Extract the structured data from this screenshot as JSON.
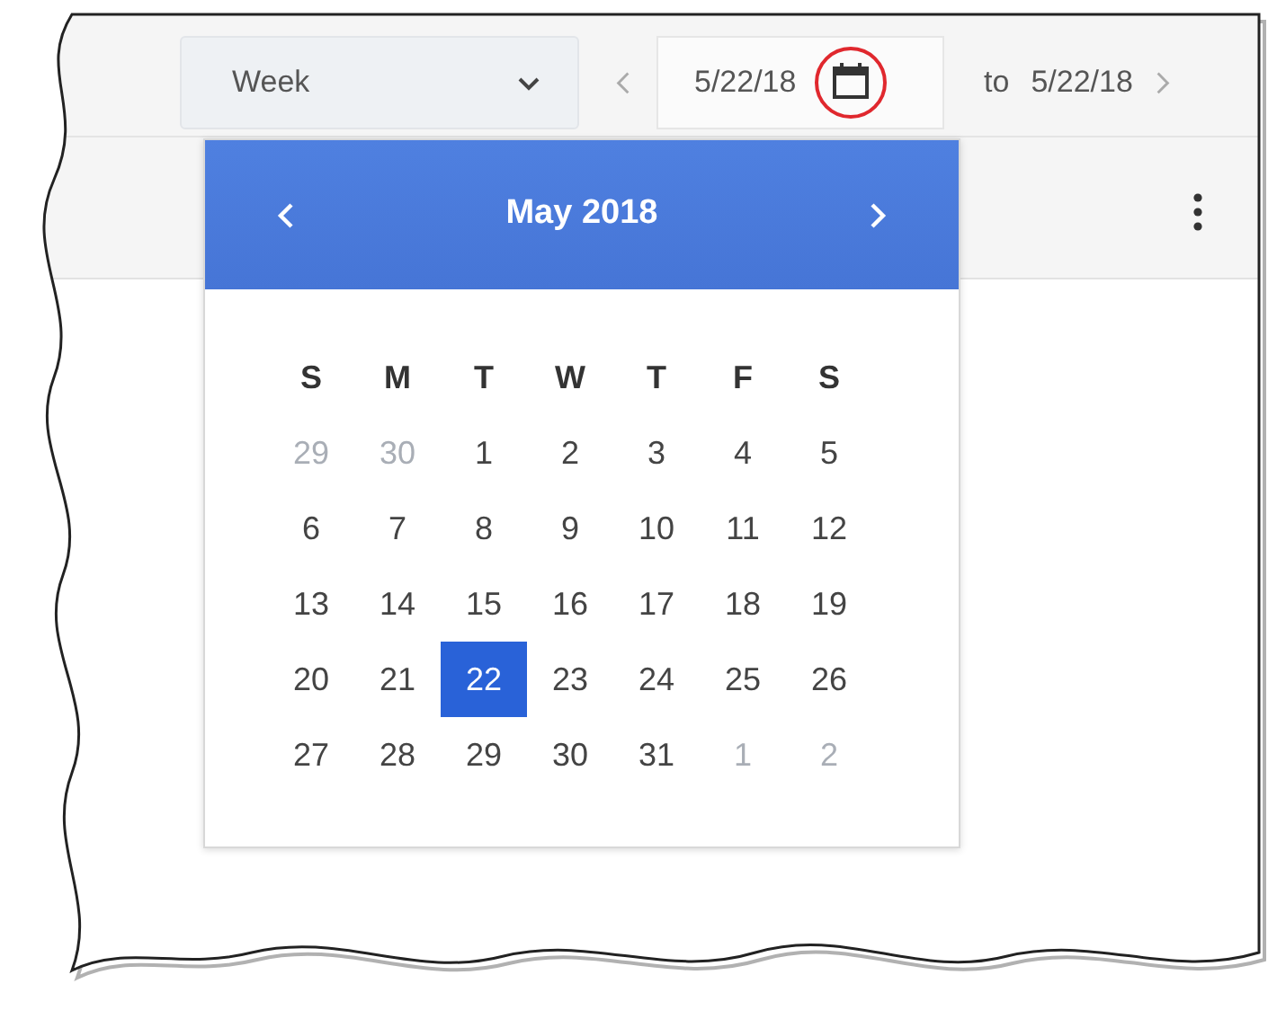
{
  "toolbar": {
    "range_select": {
      "value": "Week"
    },
    "start_date": {
      "value": "5/22/18"
    },
    "to_label": "to",
    "end_date": "5/22/18"
  },
  "date_picker": {
    "title": "May 2018",
    "weekdays": [
      "S",
      "M",
      "T",
      "W",
      "T",
      "F",
      "S"
    ],
    "weeks": [
      [
        {
          "label": "29",
          "outside": true,
          "selected": false
        },
        {
          "label": "30",
          "outside": true,
          "selected": false
        },
        {
          "label": "1",
          "outside": false,
          "selected": false
        },
        {
          "label": "2",
          "outside": false,
          "selected": false
        },
        {
          "label": "3",
          "outside": false,
          "selected": false
        },
        {
          "label": "4",
          "outside": false,
          "selected": false
        },
        {
          "label": "5",
          "outside": false,
          "selected": false
        }
      ],
      [
        {
          "label": "6",
          "outside": false,
          "selected": false
        },
        {
          "label": "7",
          "outside": false,
          "selected": false
        },
        {
          "label": "8",
          "outside": false,
          "selected": false
        },
        {
          "label": "9",
          "outside": false,
          "selected": false
        },
        {
          "label": "10",
          "outside": false,
          "selected": false
        },
        {
          "label": "11",
          "outside": false,
          "selected": false
        },
        {
          "label": "12",
          "outside": false,
          "selected": false
        }
      ],
      [
        {
          "label": "13",
          "outside": false,
          "selected": false
        },
        {
          "label": "14",
          "outside": false,
          "selected": false
        },
        {
          "label": "15",
          "outside": false,
          "selected": false
        },
        {
          "label": "16",
          "outside": false,
          "selected": false
        },
        {
          "label": "17",
          "outside": false,
          "selected": false
        },
        {
          "label": "18",
          "outside": false,
          "selected": false
        },
        {
          "label": "19",
          "outside": false,
          "selected": false
        }
      ],
      [
        {
          "label": "20",
          "outside": false,
          "selected": false
        },
        {
          "label": "21",
          "outside": false,
          "selected": false
        },
        {
          "label": "22",
          "outside": false,
          "selected": true
        },
        {
          "label": "23",
          "outside": false,
          "selected": false
        },
        {
          "label": "24",
          "outside": false,
          "selected": false
        },
        {
          "label": "25",
          "outside": false,
          "selected": false
        },
        {
          "label": "26",
          "outside": false,
          "selected": false
        }
      ],
      [
        {
          "label": "27",
          "outside": false,
          "selected": false
        },
        {
          "label": "28",
          "outside": false,
          "selected": false
        },
        {
          "label": "29",
          "outside": false,
          "selected": false
        },
        {
          "label": "30",
          "outside": false,
          "selected": false
        },
        {
          "label": "31",
          "outside": false,
          "selected": false
        },
        {
          "label": "1",
          "outside": true,
          "selected": false
        },
        {
          "label": "2",
          "outside": true,
          "selected": false
        }
      ]
    ]
  }
}
